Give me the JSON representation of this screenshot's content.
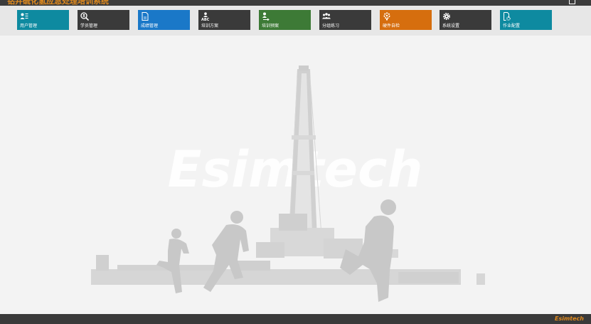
{
  "app": {
    "title": "钻井硫化氢应急处理培训系统",
    "brand": "Esimtech",
    "watermark": "Esimtech"
  },
  "toolbar": {
    "tiles": [
      {
        "label": "用户管理",
        "icon": "user-list-icon",
        "color": "#0e8aa0"
      },
      {
        "label": "学员管理",
        "icon": "student-search-icon",
        "color": "#3a3a3a"
      },
      {
        "label": "成绩管理",
        "icon": "document-icon",
        "color": "#1a78c8"
      },
      {
        "label": "培训方案",
        "icon": "abc-training-icon",
        "color": "#3a3a3a"
      },
      {
        "label": "培训预案",
        "icon": "user-arrow-icon",
        "color": "#3d7a36"
      },
      {
        "label": "分组练习",
        "icon": "group-icon",
        "color": "#3a3a3a"
      },
      {
        "label": "硬件自检",
        "icon": "hardware-check-icon",
        "color": "#d66e0e"
      },
      {
        "label": "系统设置",
        "icon": "gear-icon",
        "color": "#3a3a3a"
      },
      {
        "label": "作业配置",
        "icon": "doc-settings-icon",
        "color": "#0e8aa0"
      }
    ]
  }
}
